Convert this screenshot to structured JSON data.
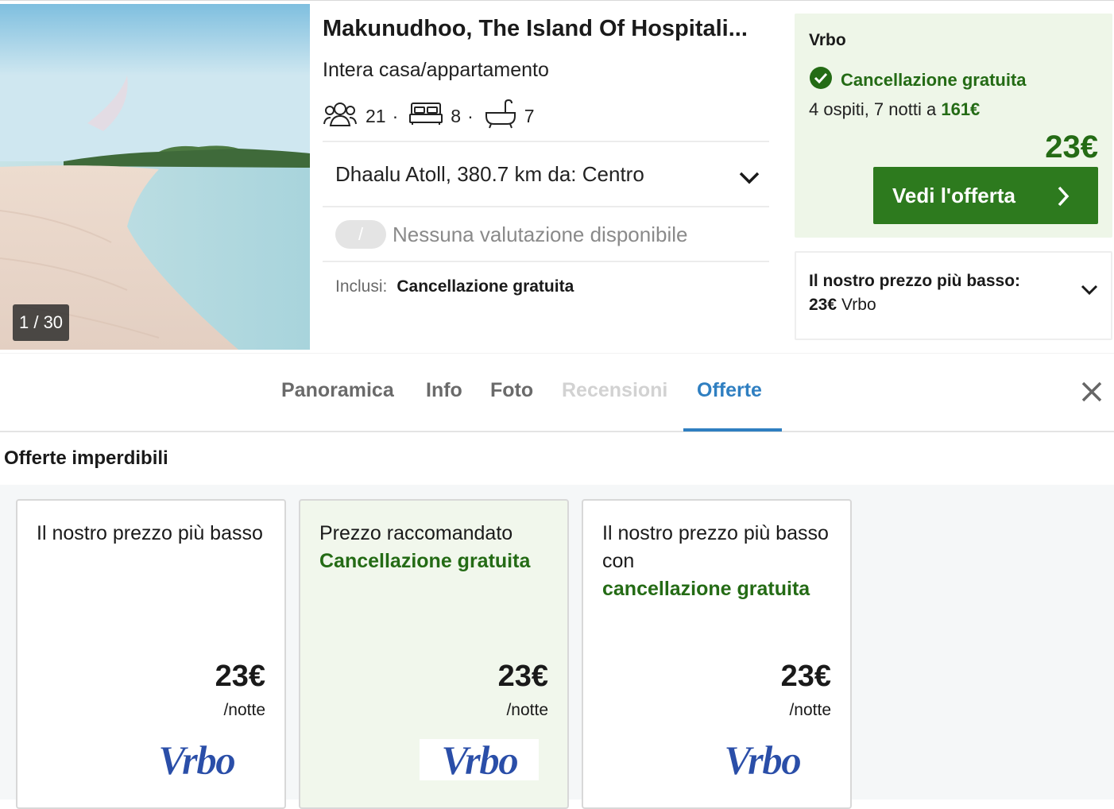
{
  "photo": {
    "counter": "1 / 30",
    "alt_icon": "beach-photo"
  },
  "hotel": {
    "title": "Makunudhoo, The Island Of Hospitali...",
    "type": "Intera casa/appartamento",
    "guests": "21",
    "bedrooms": "8",
    "bathrooms": "7",
    "location": "Dhaalu Atoll, 380.7 km da: Centro",
    "rating_badge": "/",
    "rating_text": "Nessuna valutazione disponibile",
    "included_label": "Inclusi:",
    "included_value": "Cancellazione gratuita"
  },
  "offer": {
    "provider": "Vrbo",
    "cancellation": "Cancellazione gratuita",
    "guests_prefix": "4 ospiti, 7 notti a",
    "total": "161€",
    "price": "23€",
    "button": "Vedi l'offerta",
    "accent_color": "#2d7a1e"
  },
  "lowest": {
    "label": "Il nostro prezzo più basso:",
    "price": "23€",
    "provider": "Vrbo"
  },
  "tabs": [
    {
      "label": "Panoramica",
      "state": "normal"
    },
    {
      "label": "Info",
      "state": "normal"
    },
    {
      "label": "Foto",
      "state": "normal"
    },
    {
      "label": "Recensioni",
      "state": "disabled"
    },
    {
      "label": "Offerte",
      "state": "active"
    }
  ],
  "deals_section": {
    "title": "Offerte imperdibili"
  },
  "deals": [
    {
      "title": "Il nostro prezzo più basso",
      "highlight": "",
      "price": "23€",
      "unit": "/notte",
      "logo": "Vrbo"
    },
    {
      "title": "Prezzo raccomandato",
      "highlight": "Cancellazione gratuita",
      "price": "23€",
      "unit": "/notte",
      "logo": "Vrbo"
    },
    {
      "title": "Il nostro prezzo più basso con",
      "highlight": "cancellazione gratuita",
      "price": "23€",
      "unit": "/notte",
      "logo": "Vrbo"
    }
  ]
}
